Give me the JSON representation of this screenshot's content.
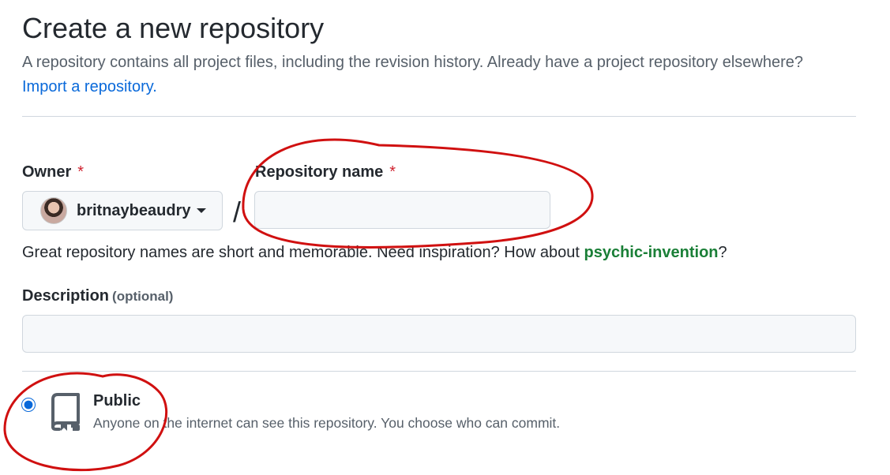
{
  "header": {
    "title": "Create a new repository",
    "subtitle": "A repository contains all project files, including the revision history. Already have a project repository elsewhere?",
    "import_link": "Import a repository."
  },
  "owner": {
    "label": "Owner",
    "required_mark": "*",
    "selected": "britnaybeaudry",
    "avatar_icon": "user-avatar"
  },
  "separator": "/",
  "repo_name": {
    "label": "Repository name",
    "required_mark": "*",
    "value": "",
    "hint_prefix": "Great repository names are short and memorable. Need inspiration? How about ",
    "suggestion": "psychic-invention",
    "hint_suffix": "?"
  },
  "description": {
    "label": "Description",
    "optional": "(optional)",
    "value": ""
  },
  "visibility": {
    "selected": "public",
    "option_label": "Public",
    "option_desc": "Anyone on the internet can see this repository. You choose who can commit.",
    "icon": "repo-icon"
  },
  "colors": {
    "accent": "#0969da",
    "required": "#cf222e",
    "suggestion": "#1a7f37",
    "annotation": "#d01010"
  }
}
